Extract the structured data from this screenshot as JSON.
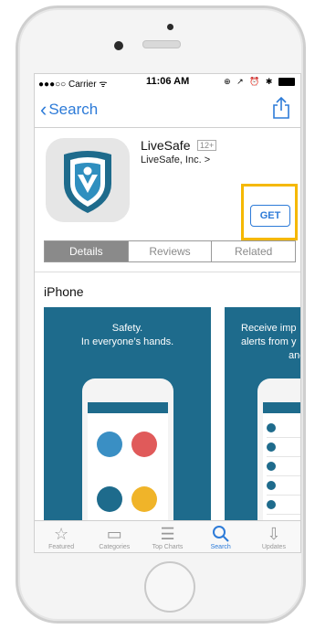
{
  "status_bar": {
    "carrier": "●●●○○ Carrier ᯤ",
    "time": "11:06 AM",
    "icons": "⊕ ↗ ⏰ ✱"
  },
  "nav": {
    "back_label": "Search"
  },
  "app": {
    "name": "LiveSafe",
    "age_rating": "12+",
    "developer": "LiveSafe, Inc. >",
    "get_label": "GET"
  },
  "segments": [
    {
      "label": "Details",
      "active": true
    },
    {
      "label": "Reviews",
      "active": false
    },
    {
      "label": "Related",
      "active": false
    }
  ],
  "device_label": "iPhone",
  "screenshots": {
    "first": {
      "line1": "Safety.",
      "line2": "In everyone’s hands."
    },
    "second": {
      "line1": "Receive imp",
      "line2": "alerts from y",
      "line3": "and"
    }
  },
  "tabbar": [
    {
      "label": "Featured",
      "icon": "star-icon",
      "active": false
    },
    {
      "label": "Categories",
      "icon": "categories-icon",
      "active": false
    },
    {
      "label": "Top Charts",
      "icon": "list-icon",
      "active": false
    },
    {
      "label": "Search",
      "icon": "search-icon",
      "active": true
    },
    {
      "label": "Updates",
      "icon": "download-icon",
      "active": false
    }
  ],
  "colors": {
    "accent": "#2d7bd8",
    "highlight": "#f5b800",
    "brand": "#1e6b8c"
  }
}
